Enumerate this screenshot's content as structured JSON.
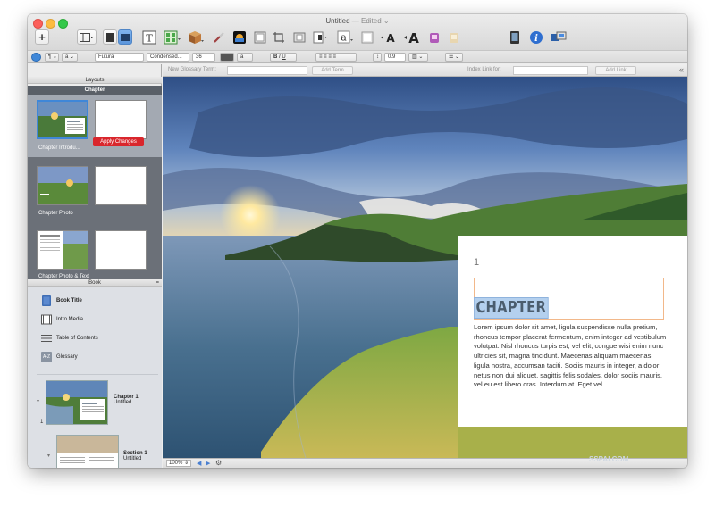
{
  "window": {
    "title": "Untitled",
    "title_sep": "—",
    "edited_label": "Edited"
  },
  "format_bar": {
    "font_family": "Futura",
    "font_style": "Condensed...",
    "font_size": "36",
    "line_spacing": "0.9"
  },
  "glossary_bar": {
    "new_term_label": "New Glossary Term:",
    "add_term_button": "Add Term",
    "index_link_label": "Index Link for:",
    "add_link_button": "Add Link"
  },
  "layouts_panel": {
    "header": "Layouts",
    "selected_section": "Chapter",
    "items": [
      {
        "label": "Chapter Introdu..."
      },
      {
        "label": "Chapter Photo"
      },
      {
        "label": "Chapter Photo & Text"
      }
    ],
    "apply_button": "Apply Changes"
  },
  "book_panel": {
    "header": "Book",
    "items": [
      {
        "label": "Book Title",
        "icon": "book-icon"
      },
      {
        "label": "Intro Media",
        "icon": "film-icon"
      },
      {
        "label": "Table of Contents",
        "icon": "list-icon"
      },
      {
        "label": "Glossary",
        "icon": "glossary-icon"
      }
    ],
    "glossary_icon_text": "A-Z",
    "chapters": [
      {
        "number": "1",
        "title": "Chapter 1",
        "subtitle": "Untitled"
      },
      {
        "number": "",
        "title": "Section 1",
        "subtitle": "Untitled"
      }
    ]
  },
  "page": {
    "page_number": "1",
    "chapter_title": "CHAPTER",
    "body": "Lorem ipsum dolor sit amet, ligula suspendisse nulla pretium, rhoncus tempor placerat fermentum, enim integer ad vestibulum volutpat. Nisl rhoncus turpis est, vel elit, congue wisi enim nunc ultricies sit, magna tincidunt. Maecenas aliquam maecenas ligula nostra, accumsan taciti. Sociis mauris in integer, a dolor netus non dui aliquet, sagittis felis sodales, dolor sociis mauris, vel eu est libero cras. Interdum at. Eget vel."
  },
  "status_bar": {
    "zoom": "100%"
  },
  "watermark": "SSPAI.COM",
  "colors": {
    "apply_button": "#d9262c",
    "selection_highlight": "#b4d0ee",
    "sidebar_dark": "#6b7078"
  }
}
